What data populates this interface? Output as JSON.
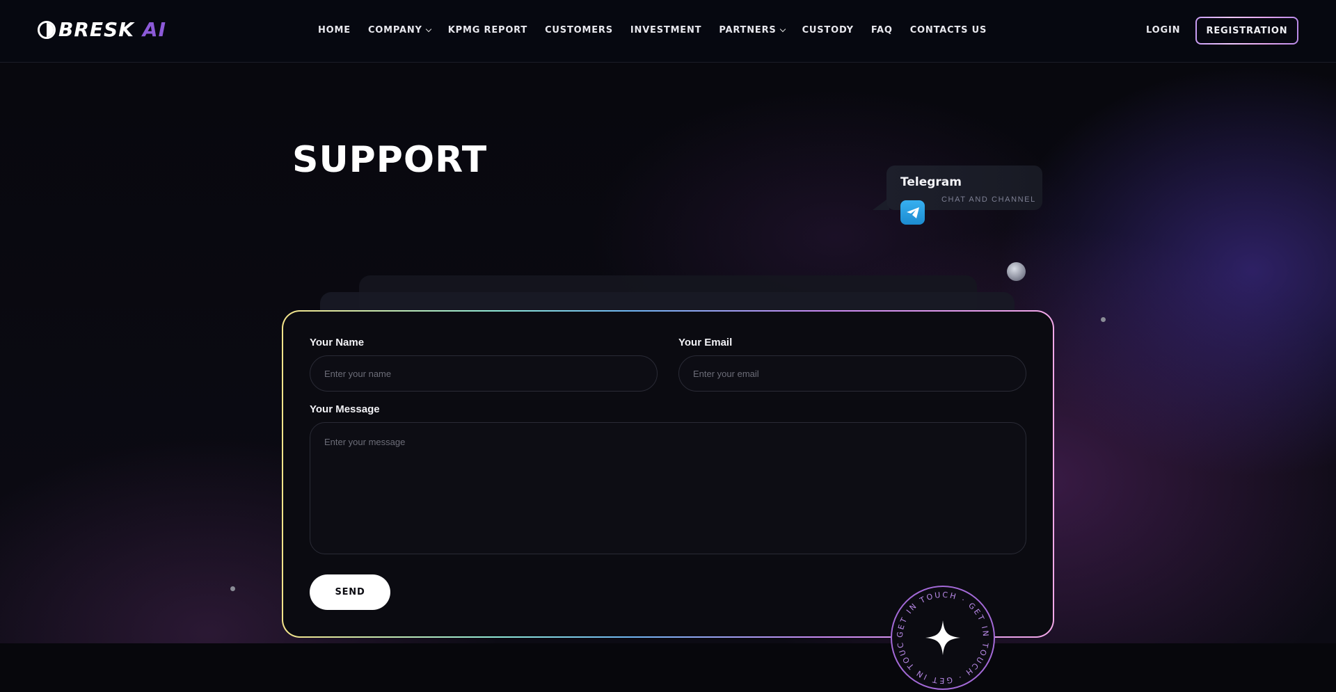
{
  "brand": {
    "name": "BRESK",
    "suffix": "AI",
    "accent": "#8c5ad8"
  },
  "nav": {
    "items": [
      {
        "label": "HOME",
        "dropdown": false
      },
      {
        "label": "COMPANY",
        "dropdown": true
      },
      {
        "label": "KPMG REPORT",
        "dropdown": false
      },
      {
        "label": "CUSTOMERS",
        "dropdown": false
      },
      {
        "label": "INVESTMENT",
        "dropdown": false
      },
      {
        "label": "PARTNERS",
        "dropdown": true
      },
      {
        "label": "CUSTODY",
        "dropdown": false
      },
      {
        "label": "FAQ",
        "dropdown": false
      },
      {
        "label": "CONTACTS US",
        "dropdown": false
      }
    ],
    "login_label": "LOGIN",
    "register_label": "REGISTRATION"
  },
  "page": {
    "title": "SUPPORT"
  },
  "telegram": {
    "title": "Telegram",
    "subtitle": "CHAT AND CHANNEL",
    "icon": "telegram-icon"
  },
  "form": {
    "name_label": "Your Name",
    "name_placeholder": "Enter your name",
    "email_label": "Your Email",
    "email_placeholder": "Enter your email",
    "message_label": "Your Message",
    "message_placeholder": "Enter your message",
    "send_label": "SEND"
  },
  "badge": {
    "text": "GET IN TOUCH · GET IN TOUCH · GET IN TOUCH · ",
    "icon": "sparkle-icon"
  }
}
